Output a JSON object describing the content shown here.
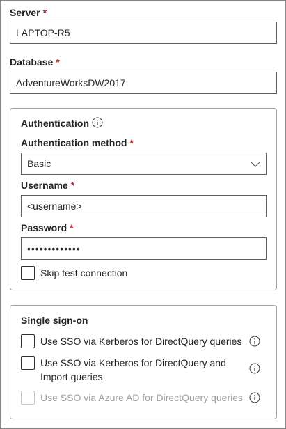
{
  "server": {
    "label": "Server",
    "required_mark": "*",
    "value": "LAPTOP-R5"
  },
  "database": {
    "label": "Database",
    "required_mark": "*",
    "value": "AdventureWorksDW2017"
  },
  "authentication": {
    "title": "Authentication",
    "method_label": "Authentication method",
    "method_required": "*",
    "method_value": "Basic",
    "username_label": "Username",
    "username_required": "*",
    "username_value": "<username>",
    "password_label": "Password",
    "password_required": "*",
    "password_value": "•••••••••••••",
    "skip_test_label": "Skip test connection"
  },
  "sso": {
    "title": "Single sign-on",
    "options": [
      {
        "label": "Use SSO via Kerberos for DirectQuery queries",
        "enabled": true,
        "checked": false
      },
      {
        "label_line1": "Use SSO via Kerberos for DirectQuery and",
        "label_line2": "Import queries",
        "enabled": true,
        "checked": false
      },
      {
        "label": "Use SSO via Azure AD for DirectQuery queries",
        "enabled": false,
        "checked": false
      }
    ]
  },
  "colors": {
    "required": "#a4262c",
    "border": "#605e5c",
    "disabled_text": "#a19f9d",
    "text": "#252423"
  },
  "icons": [
    "info-icon",
    "chevron-down-icon"
  ]
}
